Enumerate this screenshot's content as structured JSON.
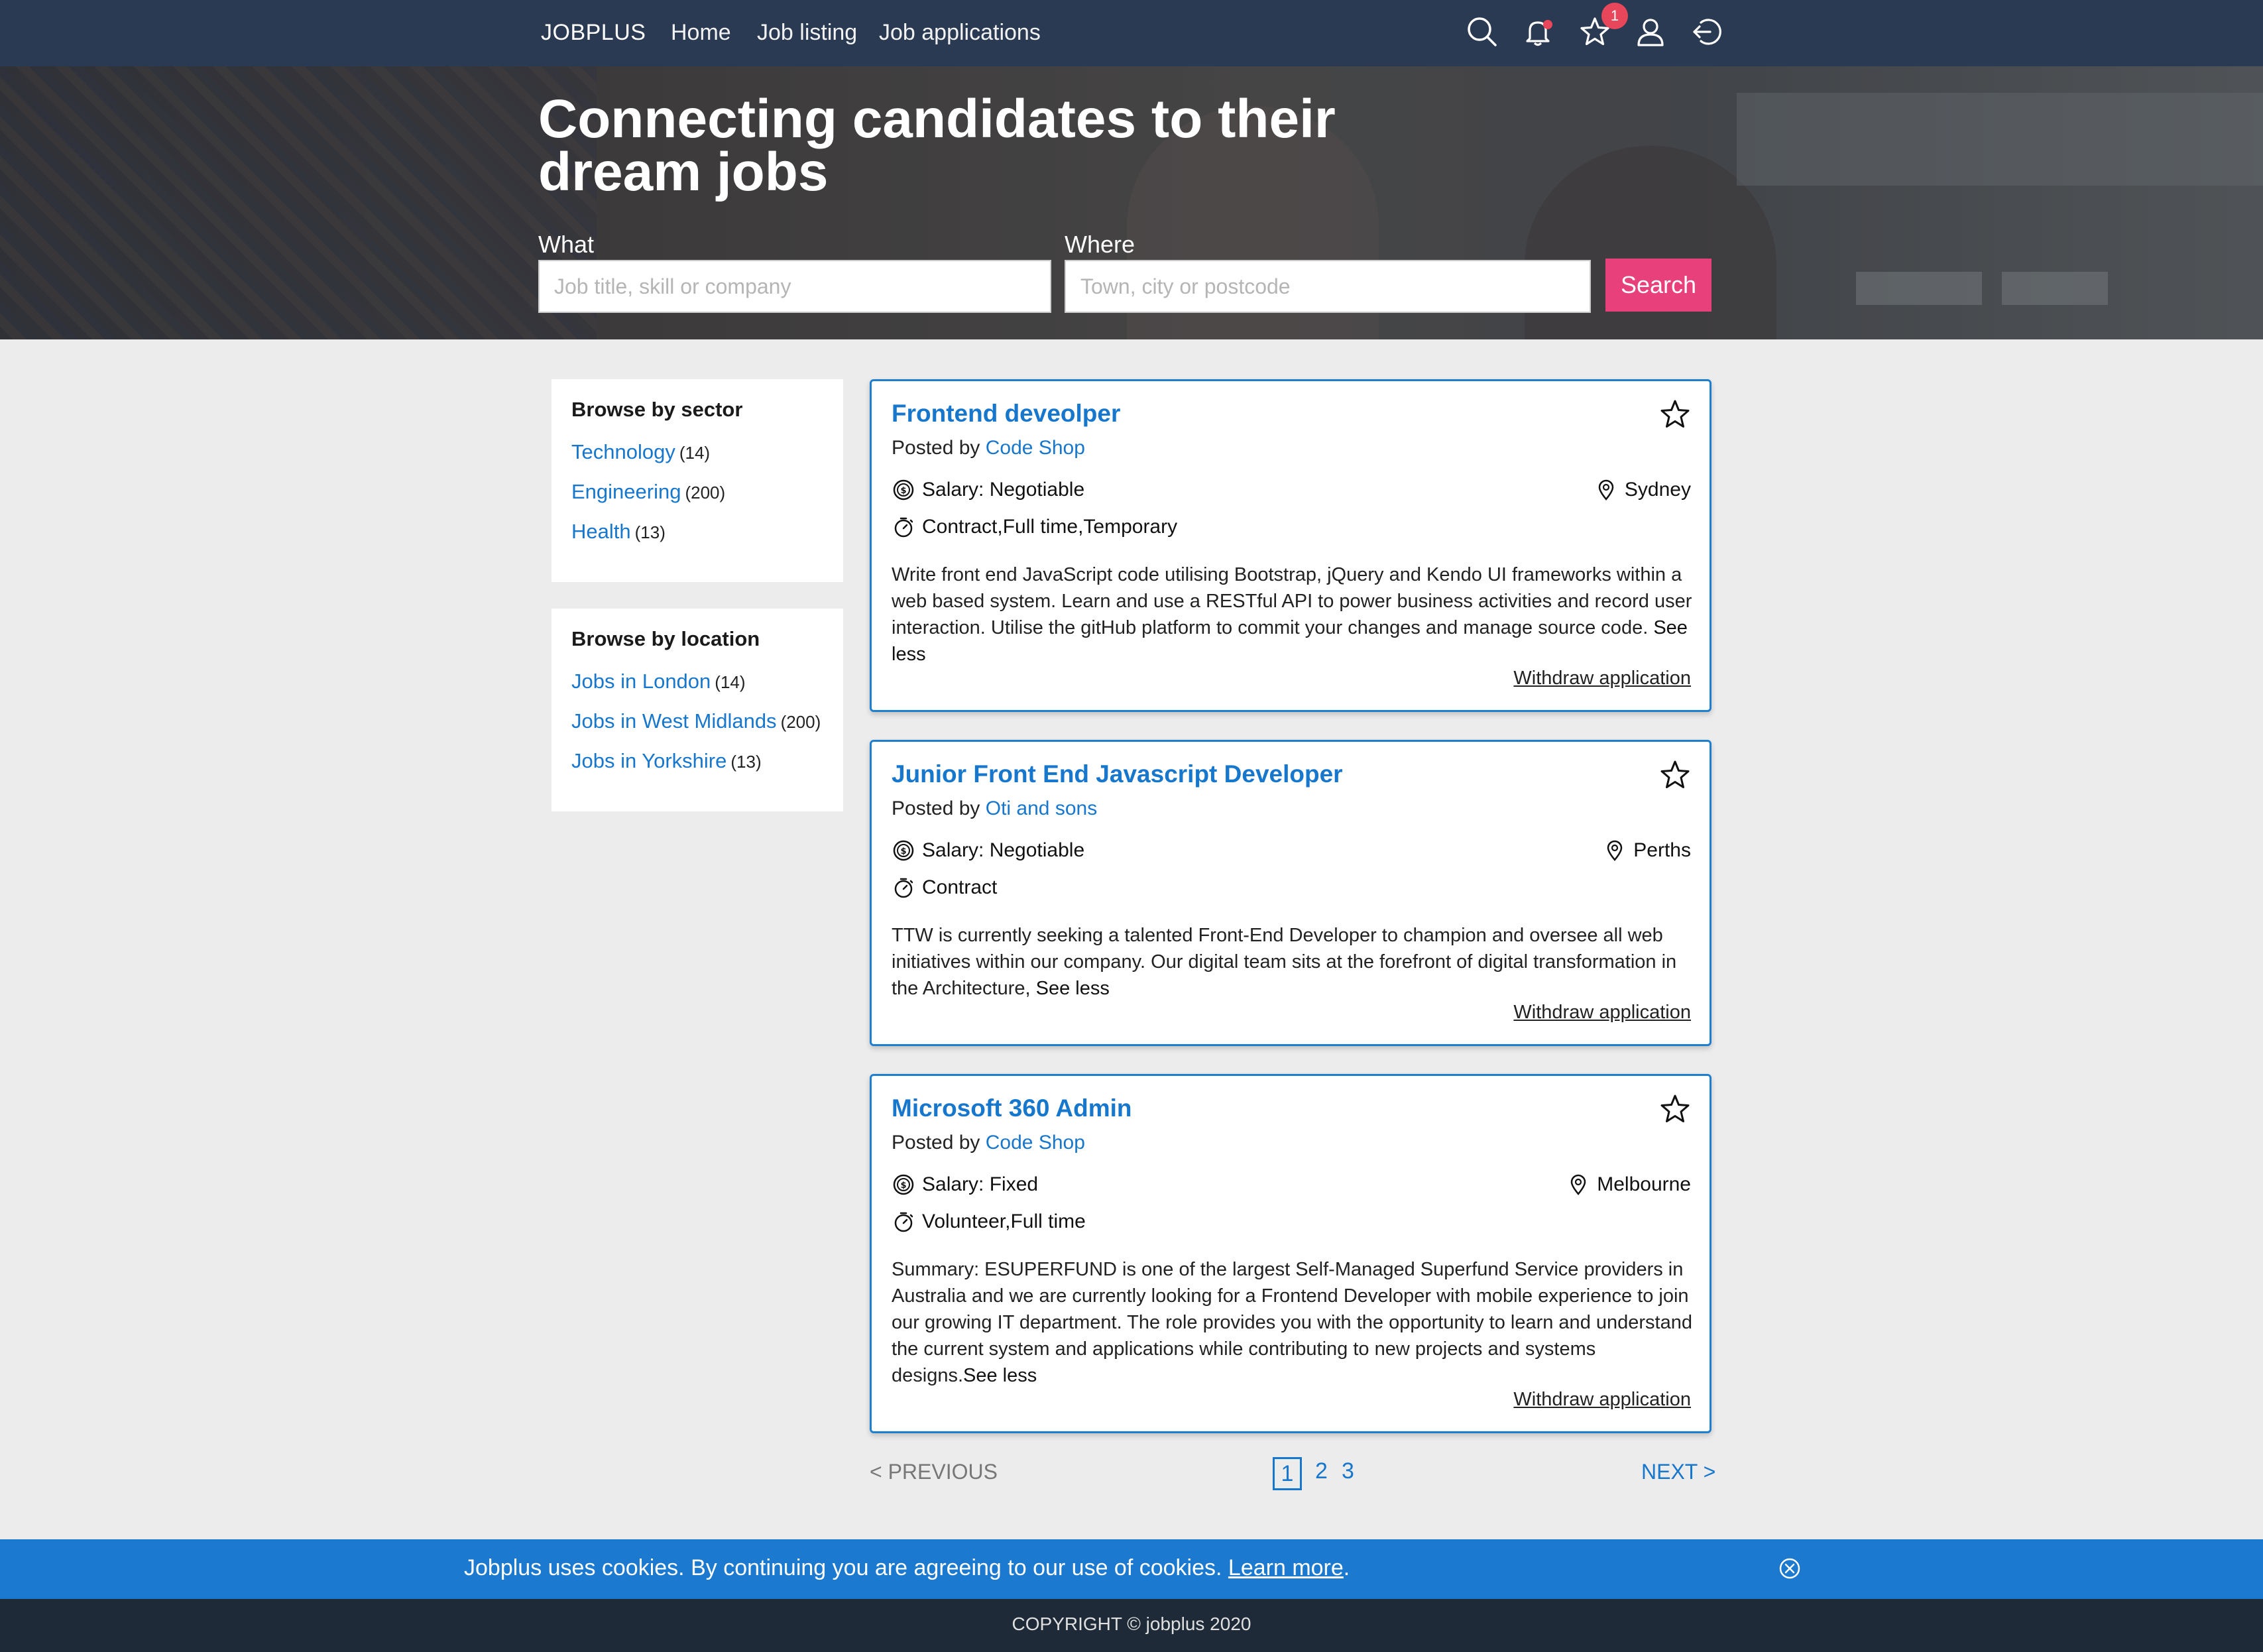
{
  "nav": {
    "brand": "JOBPLUS",
    "links": [
      "Home",
      "Job listing",
      "Job applications"
    ],
    "favorites_badge": "1",
    "icons": [
      "search-icon",
      "bell-icon",
      "star-icon",
      "user-icon",
      "logout-icon"
    ],
    "colors": {
      "nav_bg": "#2a3a52",
      "badge": "#e8465b"
    }
  },
  "hero": {
    "title": "Connecting candidates to their dream jobs",
    "what_label": "What",
    "what_placeholder": "Job title, skill or company",
    "where_label": "Where",
    "where_placeholder": "Town, city or postcode",
    "search_label": "Search",
    "search_color": "#e8407b"
  },
  "sidebar": {
    "sector": {
      "title": "Browse by sector",
      "items": [
        {
          "label": "Technology",
          "count": "(14)"
        },
        {
          "label": "Engineering",
          "count": "(200)"
        },
        {
          "label": "Health",
          "count": "(13)"
        }
      ]
    },
    "location": {
      "title": "Browse by location",
      "items": [
        {
          "label": "Jobs in London",
          "count": "(14)"
        },
        {
          "label": "Jobs in West Midlands",
          "count": "(200)"
        },
        {
          "label": "Jobs in Yorkshire",
          "count": "(13)"
        }
      ]
    }
  },
  "jobs": [
    {
      "title": "Frontend deveolper",
      "posted_prefix": "Posted by",
      "company": "Code Shop",
      "salary": "Salary: Negotiable",
      "location": "Sydney",
      "type": "Contract,Full time,Temporary",
      "description": "Write front end JavaScript code utilising Bootstrap, jQuery and Kendo UI frameworks within a web based system. Learn and use a RESTful API to power business activities and record user interaction. Utilise the gitHub platform to commit your changes and manage source code.",
      "see_less": "See less",
      "withdraw": "Withdraw application"
    },
    {
      "title": "Junior Front End Javascript Developer",
      "posted_prefix": "Posted by",
      "company": "Oti and sons",
      "salary": "Salary: Negotiable",
      "location": "Perths",
      "type": "Contract",
      "description": "TTW is currently seeking a talented Front-End Developer to champion and oversee all web initiatives within our company. Our digital team sits at the forefront of digital transformation in the Architecture,",
      "see_less": "See less",
      "withdraw": "Withdraw application"
    },
    {
      "title": "Microsoft 360 Admin",
      "posted_prefix": "Posted by",
      "company": "Code Shop",
      "salary": "Salary: Fixed",
      "location": "Melbourne",
      "type": "Volunteer,Full time",
      "description": "Summary: ESUPERFUND is one of the largest Self-Managed Superfund Service providers in Australia and we are currently looking for a Frontend Developer with mobile experience to join our growing IT department. The role provides you with the opportunity to learn and understand the current system and applications while contributing to new projects and systems designs.",
      "see_less": "See less",
      "withdraw": "Withdraw application"
    }
  ],
  "pagination": {
    "previous": "< PREVIOUS",
    "pages": [
      "1",
      "2",
      "3"
    ],
    "current": "1",
    "next": "NEXT >"
  },
  "cookie": {
    "text": "Jobplus uses cookies. By continuing you are agreeing to our use of cookies.",
    "link": "Learn more",
    "suffix": "."
  },
  "footer": {
    "copyright": "COPYRIGHT © jobplus 2020"
  }
}
